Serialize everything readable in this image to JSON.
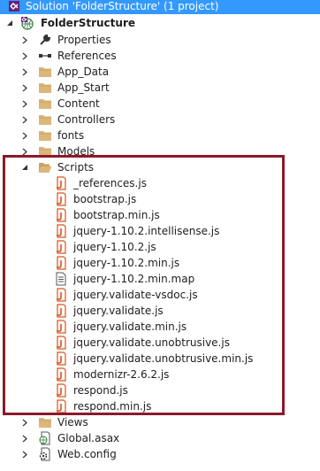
{
  "solution": {
    "label": "Solution 'FolderStructure' (1 project)",
    "project": "FolderStructure"
  },
  "project_items": [
    {
      "label": "Properties",
      "icon": "wrench-icon"
    },
    {
      "label": "References",
      "icon": "references-icon"
    },
    {
      "label": "App_Data",
      "icon": "folder-icon"
    },
    {
      "label": "App_Start",
      "icon": "folder-icon"
    },
    {
      "label": "Content",
      "icon": "folder-icon"
    },
    {
      "label": "Controllers",
      "icon": "folder-icon"
    },
    {
      "label": "fonts",
      "icon": "folder-icon"
    },
    {
      "label": "Models",
      "icon": "folder-icon"
    }
  ],
  "scripts_folder": {
    "label": "Scripts",
    "files": [
      {
        "label": "_references.js",
        "icon": "js-file-icon"
      },
      {
        "label": "bootstrap.js",
        "icon": "js-file-icon"
      },
      {
        "label": "bootstrap.min.js",
        "icon": "js-file-icon"
      },
      {
        "label": "jquery-1.10.2.intellisense.js",
        "icon": "js-file-icon"
      },
      {
        "label": "jquery-1.10.2.js",
        "icon": "js-file-icon"
      },
      {
        "label": "jquery-1.10.2.min.js",
        "icon": "js-file-icon"
      },
      {
        "label": "jquery-1.10.2.min.map",
        "icon": "map-file-icon"
      },
      {
        "label": "jquery.validate-vsdoc.js",
        "icon": "js-file-icon"
      },
      {
        "label": "jquery.validate.js",
        "icon": "js-file-icon"
      },
      {
        "label": "jquery.validate.min.js",
        "icon": "js-file-icon"
      },
      {
        "label": "jquery.validate.unobtrusive.js",
        "icon": "js-file-icon"
      },
      {
        "label": "jquery.validate.unobtrusive.min.js",
        "icon": "js-file-icon"
      },
      {
        "label": "modernizr-2.6.2.js",
        "icon": "js-file-icon"
      },
      {
        "label": "respond.js",
        "icon": "js-file-icon"
      },
      {
        "label": "respond.min.js",
        "icon": "js-file-icon"
      }
    ]
  },
  "bottom_items": [
    {
      "label": "Views",
      "icon": "folder-icon"
    },
    {
      "label": "Global.asax",
      "icon": "asax-file-icon"
    },
    {
      "label": "Web.config",
      "icon": "config-file-icon"
    }
  ],
  "colors": {
    "highlight_border": "#8b1a2b",
    "folder": "#dcb67a",
    "js_file": "#d9531e",
    "selection": "#3399ff"
  }
}
